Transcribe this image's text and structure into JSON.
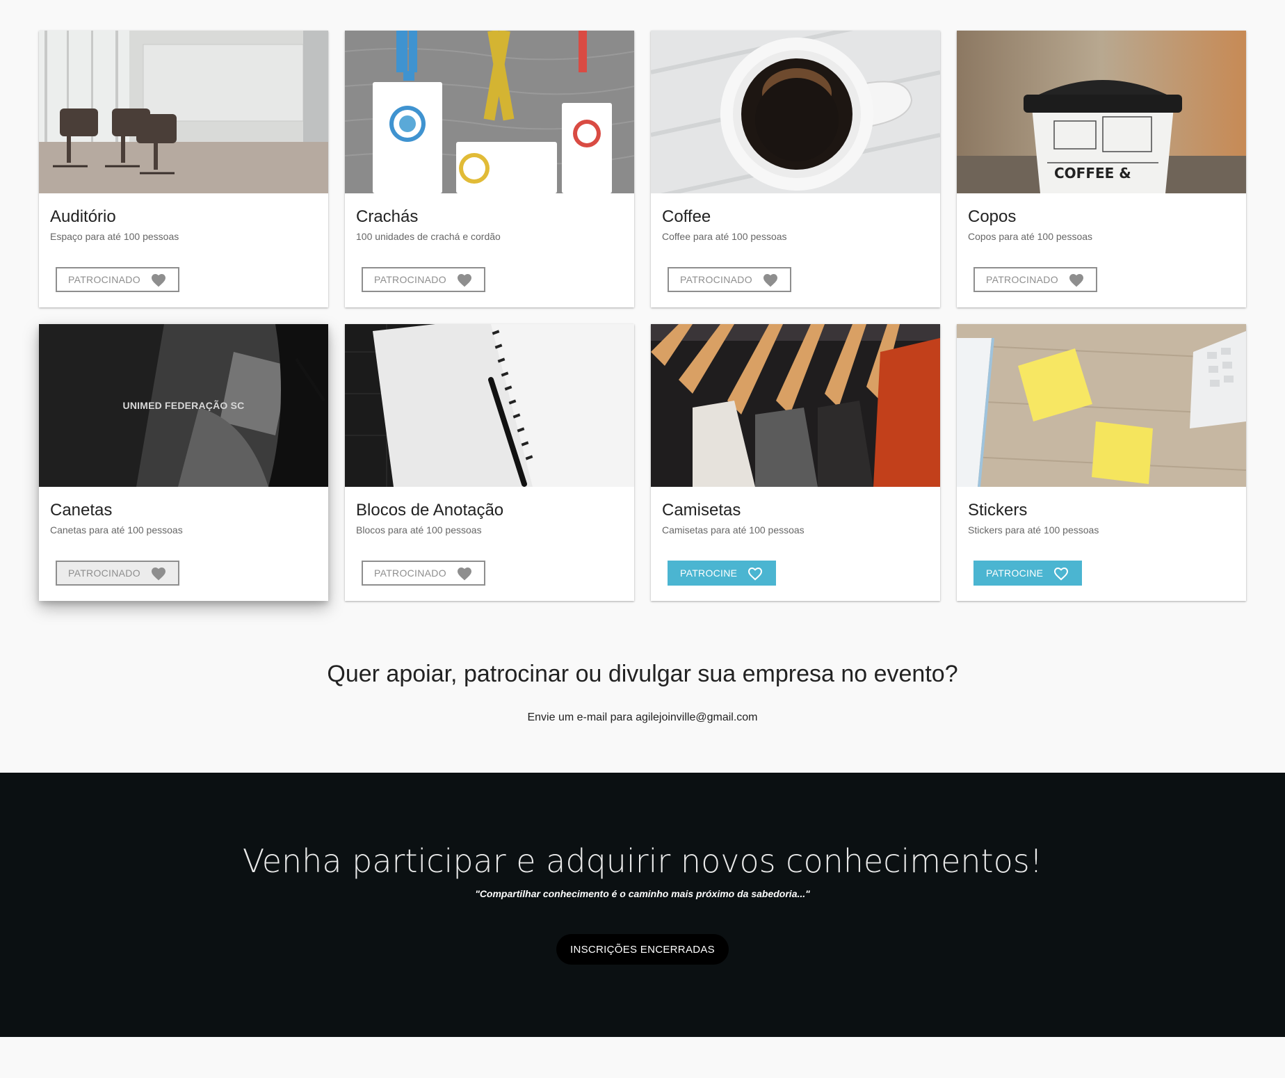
{
  "cards": [
    {
      "title": "Auditório",
      "subtitle": "Espaço para até 100 pessoas",
      "button": "PATROCINADO",
      "state": "sponsored"
    },
    {
      "title": "Crachás",
      "subtitle": "100 unidades de crachá e cordão",
      "button": "PATROCINADO",
      "state": "sponsored"
    },
    {
      "title": "Coffee",
      "subtitle": "Coffee para até 100 pessoas",
      "button": "PATROCINADO",
      "state": "sponsored"
    },
    {
      "title": "Copos",
      "subtitle": "Copos para até 100 pessoas",
      "button": "PATROCINADO",
      "state": "sponsored"
    },
    {
      "title": "Canetas",
      "subtitle": "Canetas para até 100 pessoas",
      "button": "PATROCINADO",
      "state": "sponsored",
      "overlay_text": "UNIMED FEDERAÇÃO SC"
    },
    {
      "title": "Blocos de Anotação",
      "subtitle": "Blocos para até 100 pessoas",
      "button": "PATROCINADO",
      "state": "sponsored"
    },
    {
      "title": "Camisetas",
      "subtitle": "Camisetas para até 100 pessoas",
      "button": "PATROCINE",
      "state": "available"
    },
    {
      "title": "Stickers",
      "subtitle": "Stickers para até 100 pessoas",
      "button": "PATROCINE",
      "state": "available"
    }
  ],
  "cup_print": "COFFEE &",
  "cta": {
    "heading": "Quer apoiar, patrocinar ou divulgar sua empresa no evento?",
    "text": "Envie um e-mail para agilejoinville@gmail.com"
  },
  "banner": {
    "heading": "Venha participar e adquirir novos conhecimentos!",
    "quote": "\"Compartilhar conhecimento é o caminho mais próximo da sabedoria...\"",
    "button": "INSCRIÇÕES ENCERRADAS"
  },
  "colors": {
    "accent": "#4bb5d1",
    "sponsored_border": "#8e8e8e",
    "banner_bg": "#0b1012"
  },
  "icons": {
    "sponsored": "heart-filled-icon",
    "available": "heart-outline-icon"
  }
}
